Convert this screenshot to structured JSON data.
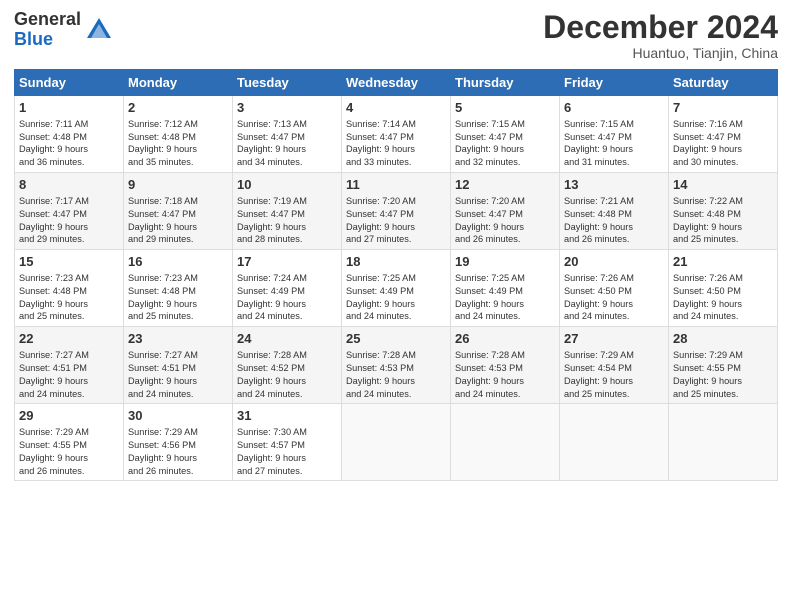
{
  "header": {
    "logo_general": "General",
    "logo_blue": "Blue",
    "month_title": "December 2024",
    "subtitle": "Huantuo, Tianjin, China"
  },
  "columns": [
    "Sunday",
    "Monday",
    "Tuesday",
    "Wednesday",
    "Thursday",
    "Friday",
    "Saturday"
  ],
  "rows": [
    [
      {
        "day": "1",
        "info": "Sunrise: 7:11 AM\nSunset: 4:48 PM\nDaylight: 9 hours\nand 36 minutes."
      },
      {
        "day": "2",
        "info": "Sunrise: 7:12 AM\nSunset: 4:48 PM\nDaylight: 9 hours\nand 35 minutes."
      },
      {
        "day": "3",
        "info": "Sunrise: 7:13 AM\nSunset: 4:47 PM\nDaylight: 9 hours\nand 34 minutes."
      },
      {
        "day": "4",
        "info": "Sunrise: 7:14 AM\nSunset: 4:47 PM\nDaylight: 9 hours\nand 33 minutes."
      },
      {
        "day": "5",
        "info": "Sunrise: 7:15 AM\nSunset: 4:47 PM\nDaylight: 9 hours\nand 32 minutes."
      },
      {
        "day": "6",
        "info": "Sunrise: 7:15 AM\nSunset: 4:47 PM\nDaylight: 9 hours\nand 31 minutes."
      },
      {
        "day": "7",
        "info": "Sunrise: 7:16 AM\nSunset: 4:47 PM\nDaylight: 9 hours\nand 30 minutes."
      }
    ],
    [
      {
        "day": "8",
        "info": "Sunrise: 7:17 AM\nSunset: 4:47 PM\nDaylight: 9 hours\nand 29 minutes."
      },
      {
        "day": "9",
        "info": "Sunrise: 7:18 AM\nSunset: 4:47 PM\nDaylight: 9 hours\nand 29 minutes."
      },
      {
        "day": "10",
        "info": "Sunrise: 7:19 AM\nSunset: 4:47 PM\nDaylight: 9 hours\nand 28 minutes."
      },
      {
        "day": "11",
        "info": "Sunrise: 7:20 AM\nSunset: 4:47 PM\nDaylight: 9 hours\nand 27 minutes."
      },
      {
        "day": "12",
        "info": "Sunrise: 7:20 AM\nSunset: 4:47 PM\nDaylight: 9 hours\nand 26 minutes."
      },
      {
        "day": "13",
        "info": "Sunrise: 7:21 AM\nSunset: 4:48 PM\nDaylight: 9 hours\nand 26 minutes."
      },
      {
        "day": "14",
        "info": "Sunrise: 7:22 AM\nSunset: 4:48 PM\nDaylight: 9 hours\nand 25 minutes."
      }
    ],
    [
      {
        "day": "15",
        "info": "Sunrise: 7:23 AM\nSunset: 4:48 PM\nDaylight: 9 hours\nand 25 minutes."
      },
      {
        "day": "16",
        "info": "Sunrise: 7:23 AM\nSunset: 4:48 PM\nDaylight: 9 hours\nand 25 minutes."
      },
      {
        "day": "17",
        "info": "Sunrise: 7:24 AM\nSunset: 4:49 PM\nDaylight: 9 hours\nand 24 minutes."
      },
      {
        "day": "18",
        "info": "Sunrise: 7:25 AM\nSunset: 4:49 PM\nDaylight: 9 hours\nand 24 minutes."
      },
      {
        "day": "19",
        "info": "Sunrise: 7:25 AM\nSunset: 4:49 PM\nDaylight: 9 hours\nand 24 minutes."
      },
      {
        "day": "20",
        "info": "Sunrise: 7:26 AM\nSunset: 4:50 PM\nDaylight: 9 hours\nand 24 minutes."
      },
      {
        "day": "21",
        "info": "Sunrise: 7:26 AM\nSunset: 4:50 PM\nDaylight: 9 hours\nand 24 minutes."
      }
    ],
    [
      {
        "day": "22",
        "info": "Sunrise: 7:27 AM\nSunset: 4:51 PM\nDaylight: 9 hours\nand 24 minutes."
      },
      {
        "day": "23",
        "info": "Sunrise: 7:27 AM\nSunset: 4:51 PM\nDaylight: 9 hours\nand 24 minutes."
      },
      {
        "day": "24",
        "info": "Sunrise: 7:28 AM\nSunset: 4:52 PM\nDaylight: 9 hours\nand 24 minutes."
      },
      {
        "day": "25",
        "info": "Sunrise: 7:28 AM\nSunset: 4:53 PM\nDaylight: 9 hours\nand 24 minutes."
      },
      {
        "day": "26",
        "info": "Sunrise: 7:28 AM\nSunset: 4:53 PM\nDaylight: 9 hours\nand 24 minutes."
      },
      {
        "day": "27",
        "info": "Sunrise: 7:29 AM\nSunset: 4:54 PM\nDaylight: 9 hours\nand 25 minutes."
      },
      {
        "day": "28",
        "info": "Sunrise: 7:29 AM\nSunset: 4:55 PM\nDaylight: 9 hours\nand 25 minutes."
      }
    ],
    [
      {
        "day": "29",
        "info": "Sunrise: 7:29 AM\nSunset: 4:55 PM\nDaylight: 9 hours\nand 26 minutes."
      },
      {
        "day": "30",
        "info": "Sunrise: 7:29 AM\nSunset: 4:56 PM\nDaylight: 9 hours\nand 26 minutes."
      },
      {
        "day": "31",
        "info": "Sunrise: 7:30 AM\nSunset: 4:57 PM\nDaylight: 9 hours\nand 27 minutes."
      },
      {
        "day": "",
        "info": ""
      },
      {
        "day": "",
        "info": ""
      },
      {
        "day": "",
        "info": ""
      },
      {
        "day": "",
        "info": ""
      }
    ]
  ]
}
